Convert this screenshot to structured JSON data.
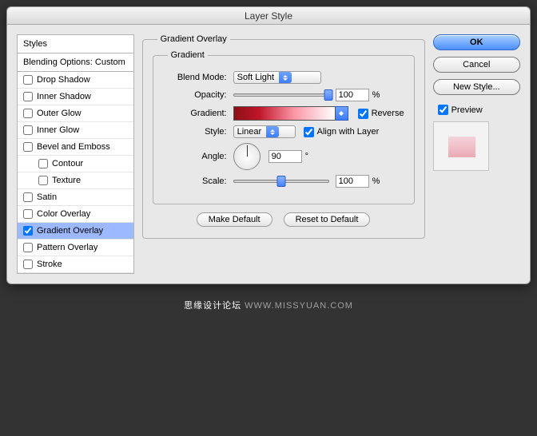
{
  "window": {
    "title": "Layer Style"
  },
  "sidebar": {
    "styles_header": "Styles",
    "blending_header": "Blending Options: Custom",
    "items": [
      {
        "label": "Drop Shadow",
        "checked": false
      },
      {
        "label": "Inner Shadow",
        "checked": false
      },
      {
        "label": "Outer Glow",
        "checked": false
      },
      {
        "label": "Inner Glow",
        "checked": false
      },
      {
        "label": "Bevel and Emboss",
        "checked": false
      },
      {
        "label": "Contour",
        "checked": false,
        "indent": true
      },
      {
        "label": "Texture",
        "checked": false,
        "indent": true
      },
      {
        "label": "Satin",
        "checked": false
      },
      {
        "label": "Color Overlay",
        "checked": false
      },
      {
        "label": "Gradient Overlay",
        "checked": true,
        "selected": true
      },
      {
        "label": "Pattern Overlay",
        "checked": false
      },
      {
        "label": "Stroke",
        "checked": false
      }
    ]
  },
  "panel": {
    "title": "Gradient Overlay",
    "subtitle": "Gradient",
    "blend_mode_label": "Blend Mode:",
    "blend_mode_value": "Soft Light",
    "opacity_label": "Opacity:",
    "opacity_value": "100",
    "opacity_unit": "%",
    "gradient_label": "Gradient:",
    "reverse_label": "Reverse",
    "reverse_checked": true,
    "style_label": "Style:",
    "style_value": "Linear",
    "align_label": "Align with Layer",
    "align_checked": true,
    "angle_label": "Angle:",
    "angle_value": "90",
    "angle_unit": "°",
    "scale_label": "Scale:",
    "scale_value": "100",
    "scale_unit": "%",
    "make_default": "Make Default",
    "reset_default": "Reset to Default"
  },
  "right": {
    "ok": "OK",
    "cancel": "Cancel",
    "new_style": "New Style...",
    "preview_label": "Preview",
    "preview_checked": true
  },
  "footer": {
    "cn": "思缘设计论坛 ",
    "url": "WWW.MISSYUAN.COM"
  }
}
